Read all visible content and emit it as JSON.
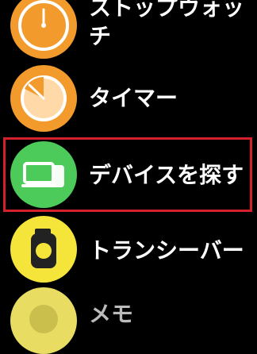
{
  "apps": [
    {
      "id": "stopwatch",
      "label": "ストップウォッチ",
      "icon": "stopwatch-icon",
      "color": "#F39A2C"
    },
    {
      "id": "timer",
      "label": "タイマー",
      "icon": "timer-icon",
      "color": "#F39A2C"
    },
    {
      "id": "find-devices",
      "label": "デバイスを探す",
      "icon": "find-devices-icon",
      "color": "#4CCB5A",
      "highlighted": true
    },
    {
      "id": "walkie-talkie",
      "label": "トランシーバー",
      "icon": "walkie-talkie-icon",
      "color": "#F5E53A"
    },
    {
      "id": "partial",
      "label": "メモ",
      "icon": "app-icon",
      "color": "#E9DC63"
    }
  ],
  "colors": {
    "highlight_border": "#D4202B",
    "background": "#000000"
  }
}
